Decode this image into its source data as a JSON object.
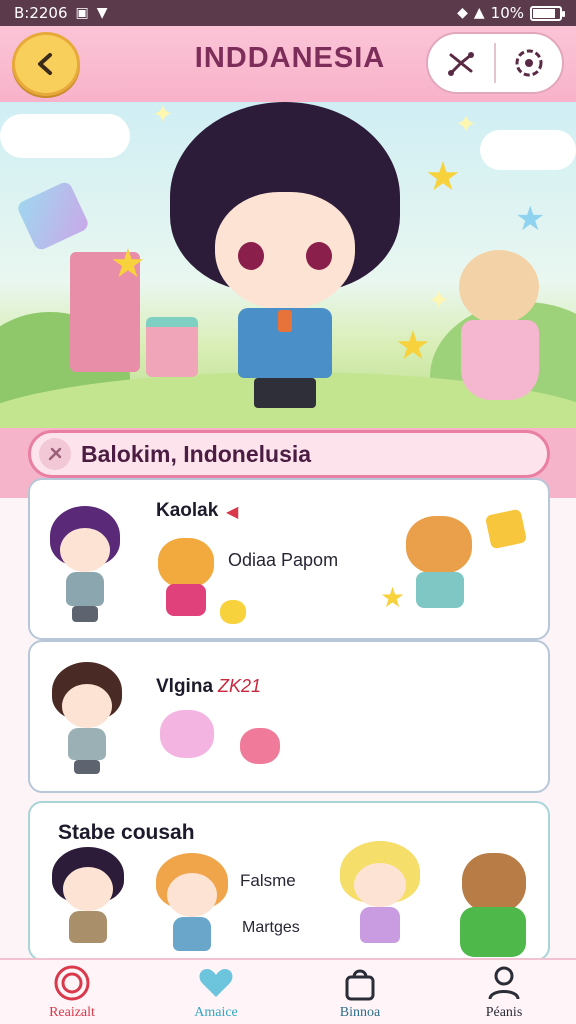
{
  "status_bar": {
    "time": "B:2206",
    "battery": "10%",
    "battery_level": 0.85
  },
  "header": {
    "title": "INDDANESIA",
    "back_icon": "chevron-left-icon",
    "action_icons": [
      "share-icon",
      "settings-icon"
    ]
  },
  "hero": {
    "scene": "chibi-character-park"
  },
  "location": {
    "text": "Balokim, Indonelusia",
    "icon": "pin-icon"
  },
  "cards": [
    {
      "title": "Kaolak",
      "subtitle": "Odiaa  Papom"
    },
    {
      "title": "Vlgina",
      "badge": "ZK21"
    },
    {
      "title": "Stabe cousah",
      "subtitle_1": "Falsme",
      "subtitle_2": "Martges"
    }
  ],
  "bottom_nav": {
    "items": [
      {
        "label": "Reaizalt",
        "icon": "home-icon",
        "color": "#d9394b"
      },
      {
        "label": "Amaice",
        "icon": "heart-icon",
        "color": "#33a8c2"
      },
      {
        "label": "Binnoa",
        "icon": "bag-icon",
        "color": "#2f6e8a"
      },
      {
        "label": "Péanis",
        "icon": "profile-icon",
        "color": "#2a2d37"
      }
    ]
  },
  "colors": {
    "accent": "#e97fa3",
    "header": "#f8b2c9",
    "title": "#7c2d5a"
  }
}
